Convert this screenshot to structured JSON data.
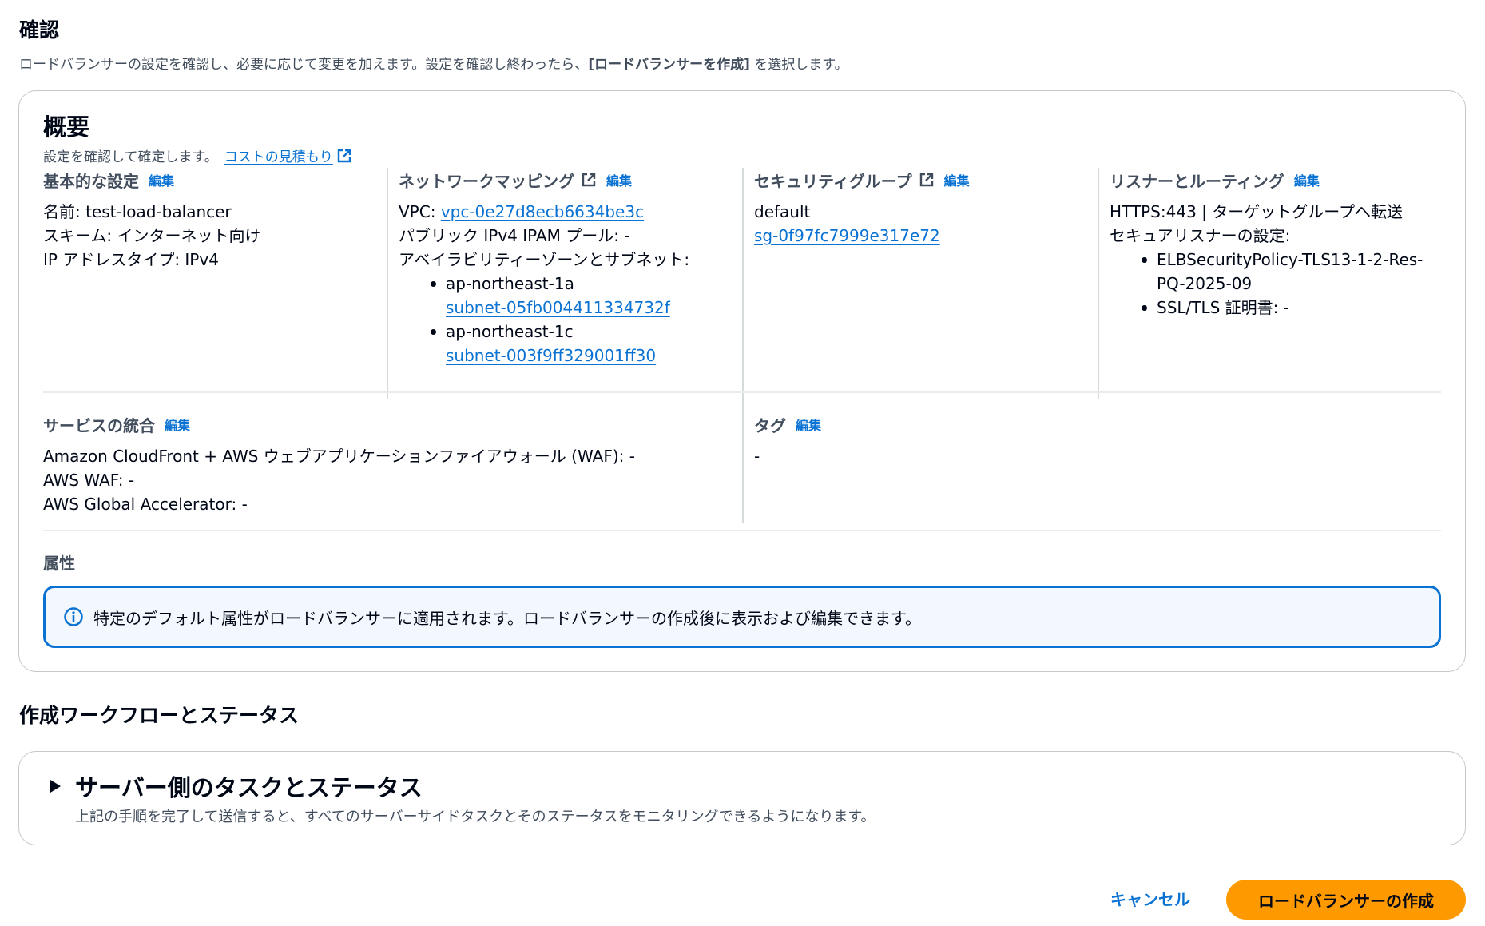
{
  "review": {
    "title": "確認",
    "description_prefix": "ロードバランサーの設定を確認し、必要に応じて変更を加えます。設定を確認し終わったら、",
    "description_bold": "[ロードバランサーを作成]",
    "description_suffix": " を選択します。"
  },
  "summary": {
    "title": "概要",
    "subtitle": "設定を確認して確定します。",
    "cost_link": "コストの見積もり"
  },
  "basic": {
    "title": "基本的な設定",
    "edit": "編集",
    "name": "名前: test-load-balancer",
    "scheme": "スキーム: インターネット向け",
    "ip_type": "IP アドレスタイプ: IPv4"
  },
  "network": {
    "title": "ネットワークマッピング",
    "edit": "編集",
    "vpc_label": "VPC: ",
    "vpc_id": "vpc-0e27d8ecb6634be3c",
    "ipam": "パブリック IPv4 IPAM プール: -",
    "az_label": "アベイラビリティーゾーンとサブネット:",
    "zones": [
      {
        "az": "ap-northeast-1a",
        "subnet": "subnet-05fb004411334732f"
      },
      {
        "az": "ap-northeast-1c",
        "subnet": "subnet-003f9ff329001ff30"
      }
    ]
  },
  "security": {
    "title": "セキュリティグループ",
    "edit": "編集",
    "group_name": "default",
    "group_id": "sg-0f97fc7999e317e72"
  },
  "listener": {
    "title": "リスナーとルーティング",
    "edit": "編集",
    "rule": "HTTPS:443 | ターゲットグループへ転送",
    "secure_label": "セキュアリスナーの設定:",
    "policy_line1": "ELBSecurityPolicy-TLS13-1-2-Res-",
    "policy_line2": "PQ-2025-09",
    "cert": "SSL/TLS 証明書: -"
  },
  "integration": {
    "title": "サービスの統合",
    "edit": "編集",
    "cloudfront": "Amazon CloudFront + AWS ウェブアプリケーションファイアウォール (WAF): -",
    "waf": "AWS WAF: -",
    "accelerator": "AWS Global Accelerator: -"
  },
  "tags": {
    "title": "タグ",
    "edit": "編集",
    "value": "-"
  },
  "attributes": {
    "title": "属性",
    "info": "特定のデフォルト属性がロードバランサーに適用されます。ロードバランサーの作成後に表示および編集できます。"
  },
  "workflow": {
    "title": "作成ワークフローとステータス",
    "section_title": "サーバー側のタスクとステータス",
    "section_desc": "上記の手順を完了して送信すると、すべてのサーバーサイドタスクとそのステータスをモニタリングできるようになります。"
  },
  "actions": {
    "cancel": "キャンセル",
    "create": "ロードバランサーの作成"
  },
  "colors": {
    "link": "#0972d3",
    "primary_button": "#ff9900",
    "info_border": "#0972d3",
    "info_bg": "#f2f8fd"
  },
  "icons": [
    "external-link-icon",
    "info-icon",
    "caret-right-icon"
  ]
}
